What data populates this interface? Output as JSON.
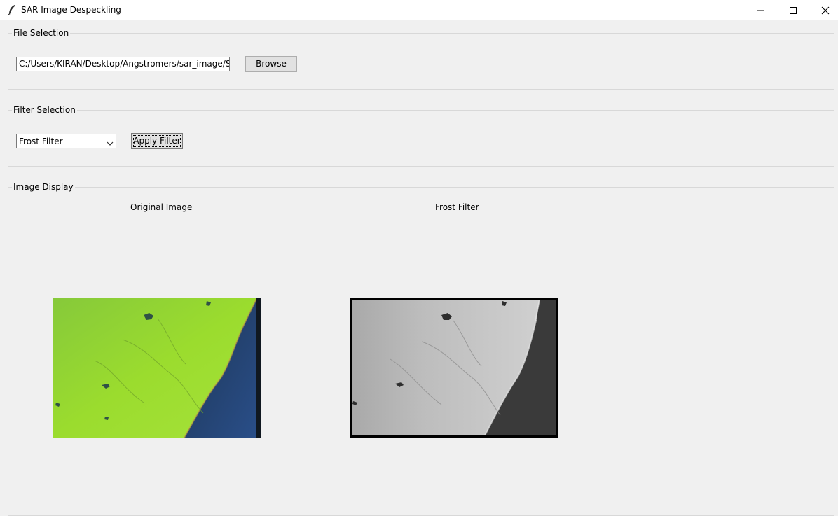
{
  "window": {
    "title": "SAR Image Despeckling",
    "controls": [
      "minimize-icon",
      "maximize-icon",
      "close-icon"
    ]
  },
  "file_selection": {
    "legend": "File Selection",
    "path_value": "C:/Users/KIRAN/Desktop/Angstromers/sar_image/SAR_d",
    "browse_label": "Browse"
  },
  "filter_selection": {
    "legend": "Filter Selection",
    "selected_filter": "Frost Filter",
    "apply_label": "Apply Filter"
  },
  "image_display": {
    "legend": "Image Display",
    "original_caption": "Original Image",
    "filtered_caption": "Frost Filter"
  },
  "colors": {
    "window_bg": "#f0f0f0",
    "land_green": "#8ed12f",
    "water_blue": "#1f3f70",
    "filtered_gray": "#b8b8b8"
  }
}
